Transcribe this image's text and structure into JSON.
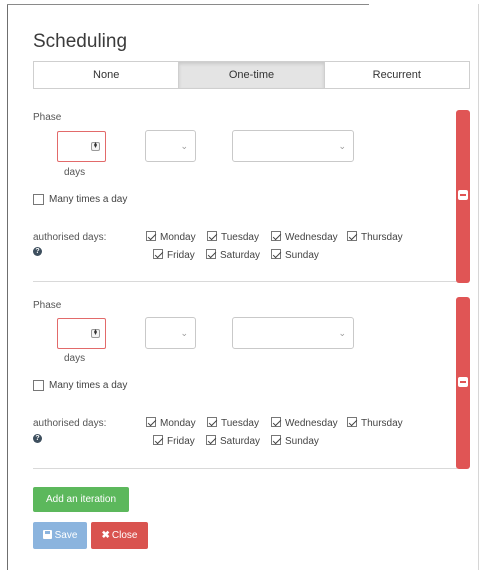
{
  "title": "Scheduling",
  "tabs": [
    {
      "label": "None",
      "active": false
    },
    {
      "label": "One-time",
      "active": true
    },
    {
      "label": "Recurrent",
      "active": false
    }
  ],
  "iterations": [
    {
      "phase_label": "Phase",
      "number_value": "",
      "unit_label": "days",
      "select1_value": "",
      "select2_value": "",
      "many_times_label": "Many times a day",
      "many_times_checked": false,
      "authorised_label": "authorised days:",
      "days": [
        {
          "label": "Monday",
          "checked": true
        },
        {
          "label": "Tuesday",
          "checked": true
        },
        {
          "label": "Wednesday",
          "checked": true
        },
        {
          "label": "Thursday",
          "checked": true
        },
        {
          "label": "Friday",
          "checked": true
        },
        {
          "label": "Saturday",
          "checked": true
        },
        {
          "label": "Sunday",
          "checked": true
        }
      ]
    },
    {
      "phase_label": "Phase",
      "number_value": "",
      "unit_label": "days",
      "select1_value": "",
      "select2_value": "",
      "many_times_label": "Many times a day",
      "many_times_checked": false,
      "authorised_label": "authorised days:",
      "days": [
        {
          "label": "Monday",
          "checked": true
        },
        {
          "label": "Tuesday",
          "checked": true
        },
        {
          "label": "Wednesday",
          "checked": true
        },
        {
          "label": "Thursday",
          "checked": true
        },
        {
          "label": "Friday",
          "checked": true
        },
        {
          "label": "Saturday",
          "checked": true
        },
        {
          "label": "Sunday",
          "checked": true
        }
      ]
    }
  ],
  "buttons": {
    "add_iteration": "Add an iteration",
    "save": "Save",
    "close": "Close",
    "close_icon_glyph": "✖"
  },
  "icons": {
    "help": "?",
    "spinner": "⬍",
    "chevron": "⌄"
  },
  "colors": {
    "add_button": "#5cb85c",
    "save_button": "#8bb4de",
    "close_button": "#d9534f",
    "remove_bar": "#e05555",
    "input_error_border": "#e26a6a"
  }
}
